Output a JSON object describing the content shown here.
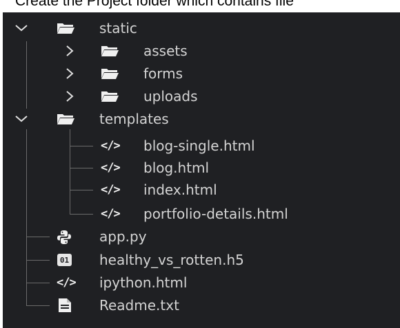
{
  "caption": "Create the Project folder which contains file",
  "tree": {
    "static": {
      "label": "static",
      "icon": "folder-open-icon",
      "expanded": true
    },
    "assets": {
      "label": "assets",
      "icon": "folder-open-icon"
    },
    "forms": {
      "label": "forms",
      "icon": "folder-open-icon"
    },
    "uploads": {
      "label": "uploads",
      "icon": "folder-open-icon"
    },
    "templates": {
      "label": "templates",
      "icon": "folder-open-icon",
      "expanded": true
    },
    "blog_single": {
      "label": "blog-single.html",
      "icon": "html-code-icon"
    },
    "blog": {
      "label": "blog.html",
      "icon": "html-code-icon"
    },
    "index": {
      "label": "index.html",
      "icon": "html-code-icon"
    },
    "portfolio_details": {
      "label": "portfolio-details.html",
      "icon": "html-code-icon"
    },
    "app_py": {
      "label": "app.py",
      "icon": "python-icon"
    },
    "h5": {
      "label": "healthy_vs_rotten.h5",
      "icon": "binary-file-icon",
      "badge": "01"
    },
    "ipython": {
      "label": "ipython.html",
      "icon": "html-code-icon"
    },
    "readme": {
      "label": "Readme.txt",
      "icon": "text-file-icon"
    }
  },
  "code_glyph": "</>",
  "colors": {
    "background": "#1f2023",
    "text": "#d4d4d4",
    "guide": "#6b6b6b",
    "icon": "#f0f0f0"
  }
}
